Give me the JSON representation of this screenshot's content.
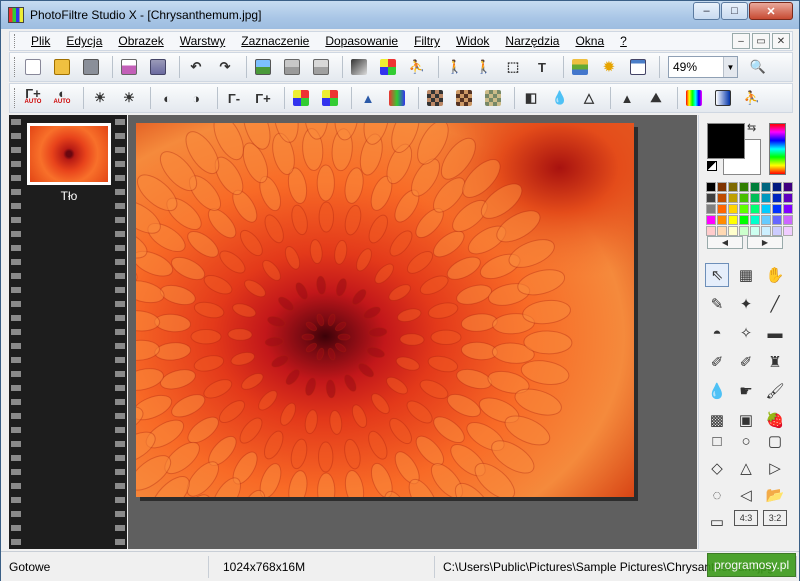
{
  "window": {
    "title": "PhotoFiltre Studio X - [Chrysanthemum.jpg]",
    "minimize": "–",
    "maximize": "□",
    "close": "✕"
  },
  "menu": {
    "items": [
      "Plik",
      "Edycja",
      "Obrazek",
      "Warstwy",
      "Zaznaczenie",
      "Dopasowanie",
      "Filtry",
      "Widok",
      "Narzędzia",
      "Okna",
      "?"
    ],
    "mdi": [
      "–",
      "▭",
      "✕"
    ]
  },
  "toolbar1": {
    "icons": [
      "new-icon",
      "open-icon",
      "save-icon",
      "print-icon",
      "scan-icon",
      "undo-icon",
      "redo-icon",
      "image-icon",
      "image-copy-icon",
      "image-paste-icon",
      "gradient-icon",
      "color-grid-icon",
      "transform-icon",
      "walk-left-icon",
      "walk-right-icon",
      "selection-icon",
      "text-icon",
      "layers-icon",
      "sun-icon",
      "window-icon"
    ],
    "zoom": "49%"
  },
  "toolbar2": {
    "labels": {
      "gamma_auto1": "Γ+",
      "gamma_minus": "Γ-",
      "gamma_plus": "Γ+"
    },
    "auto_text": "AUTO"
  },
  "layers": {
    "thumb_label": "Tło"
  },
  "colors": {
    "foreground": "#000000",
    "background": "#ffffff",
    "palette": [
      "#000000",
      "#7f3300",
      "#7f6a00",
      "#307f00",
      "#007f3a",
      "#00667f",
      "#00187f",
      "#3f007f",
      "#404040",
      "#bf4c00",
      "#bfa000",
      "#48bf00",
      "#00bf57",
      "#0099bf",
      "#0024bf",
      "#5f00bf",
      "#808080",
      "#ff6600",
      "#ffd400",
      "#60ff00",
      "#00ff74",
      "#00ccff",
      "#0030ff",
      "#7f00ff",
      "#ff00ff",
      "#ff8c00",
      "#ffff00",
      "#00ff00",
      "#00ffcc",
      "#66ccff",
      "#6666ff",
      "#cc66ff",
      "#ffcccc",
      "#ffd9b3",
      "#ffffcc",
      "#ccffcc",
      "#ccfff0",
      "#ccf0ff",
      "#ccccff",
      "#f0ccff"
    ]
  },
  "tools": {
    "items": [
      "pointer-icon",
      "picture-frame-icon",
      "hand-icon",
      "eyedropper-icon",
      "magic-wand-icon",
      "line-icon",
      "fill-bucket-icon",
      "spray-icon",
      "eraser-icon",
      "brush-icon",
      "advanced-brush-icon",
      "stamp-icon",
      "blur-drop-icon",
      "smudge-icon",
      "clone-icon",
      "mesh-icon",
      "portrait-icon",
      "strawberry-icon"
    ],
    "glyphs": [
      "⇖",
      "▦",
      "✋",
      "✎",
      "✦",
      "╱",
      "◓",
      "✧",
      "▬",
      "✐",
      "✐",
      "♜",
      "💧",
      "☛",
      "🖌",
      "▩",
      "▣",
      "🍓"
    ]
  },
  "shapes": {
    "items": [
      "rectangle-icon",
      "ellipse-icon",
      "rounded-rect-icon",
      "diamond-icon",
      "triangle-icon",
      "play-triangle-icon",
      "lasso-icon",
      "polygon-icon",
      "folder-open-icon",
      "fit-icon",
      "ratio-4-3-icon",
      "ratio-3-2-icon"
    ],
    "glyphs": [
      "□",
      "○",
      "▢",
      "◇",
      "△",
      "▷",
      "◌",
      "◁",
      "📂",
      "▭",
      "4:3",
      "3:2"
    ]
  },
  "status": {
    "ready": "Gotowe",
    "size": "1024x768x16M",
    "path": "C:\\Users\\Public\\Pictures\\Sample Pictures\\Chrysanthemum.jpg",
    "watermark": "programosy.pl"
  }
}
